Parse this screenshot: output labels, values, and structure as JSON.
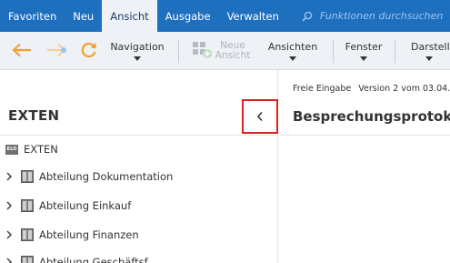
{
  "menu": {
    "tabs": [
      {
        "label": "Favoriten"
      },
      {
        "label": "Neu"
      },
      {
        "label": "Ansicht"
      },
      {
        "label": "Ausgabe"
      },
      {
        "label": "Verwalten"
      }
    ],
    "active_tab": "Ansicht",
    "search_placeholder": "Funktionen durchsuchen"
  },
  "toolbar": {
    "navigation_label": "Navigation",
    "new_view_label_line1": "Neue",
    "new_view_label_line2": "Ansicht",
    "views_label": "Ansichten",
    "window_label": "Fenster",
    "display_label": "Darstell"
  },
  "left_panel": {
    "title": "EXTEN",
    "root_label": "EXTEN",
    "root_icon_text": "ELO",
    "items": [
      {
        "label": "Abteilung Dokumentation"
      },
      {
        "label": "Abteilung Einkauf"
      },
      {
        "label": "Abteilung Finanzen"
      },
      {
        "label": "Abteilung Geschäftsf..."
      }
    ]
  },
  "right_panel": {
    "meta_type": "Freie Eingabe",
    "meta_version": "Version 2 vom 03.04.",
    "title": "Besprechungsprotoko"
  },
  "colors": {
    "menubar": "#1f6fbf",
    "toolbar": "#eef1f5",
    "arrow_orange": "#f0a030",
    "highlight_red": "#e02020"
  }
}
